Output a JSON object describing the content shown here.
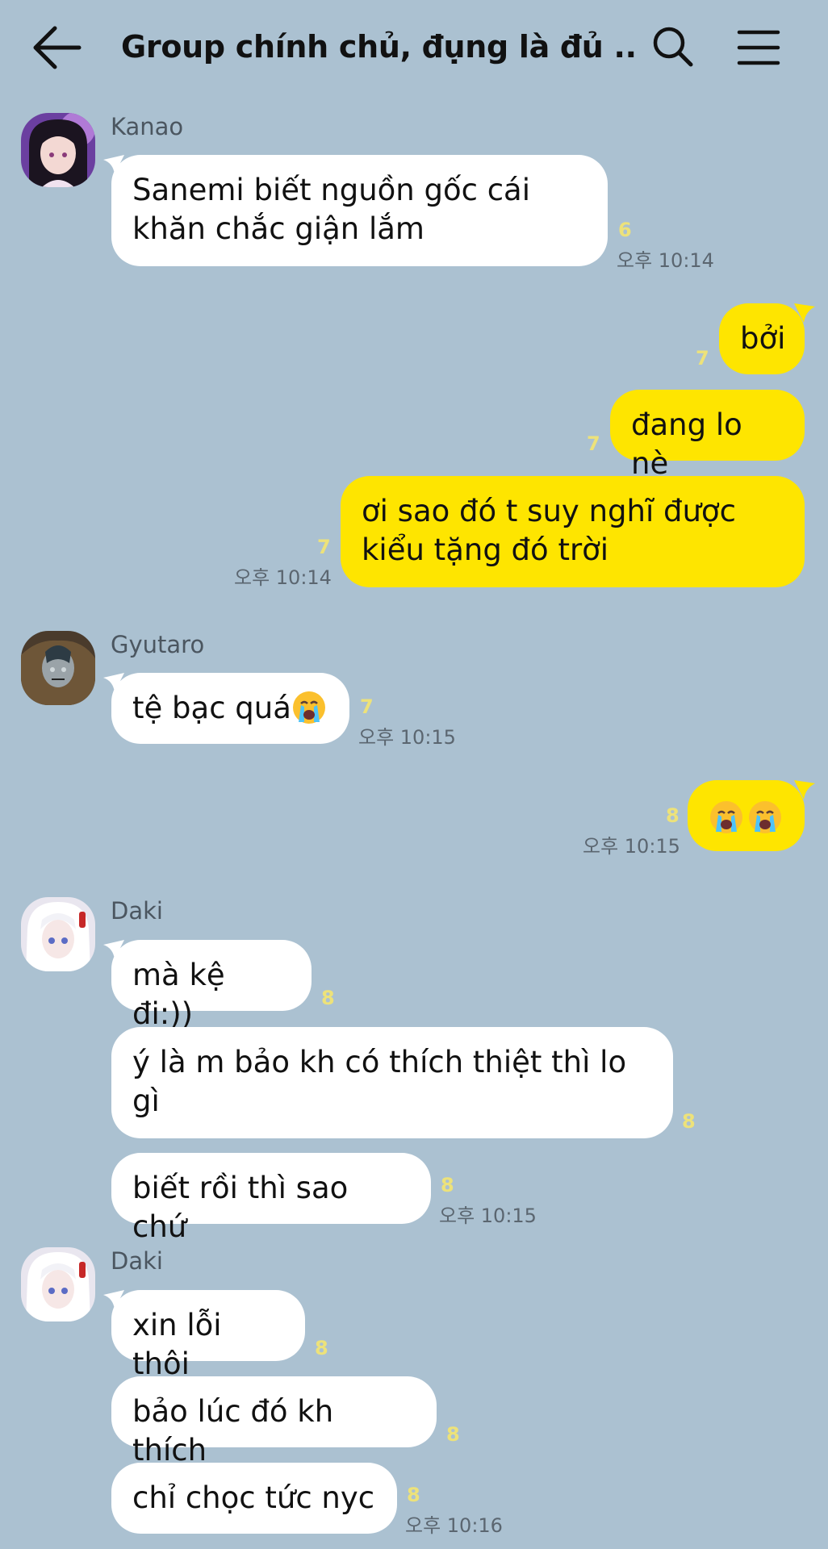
{
  "header": {
    "title": "Group chính chủ, đụng là đủ ...",
    "back_icon": "arrow-left-icon",
    "search_icon": "search-icon",
    "menu_icon": "hamburger-menu-icon"
  },
  "colors": {
    "background": "#abc1d1",
    "incoming_bubble": "#ffffff",
    "outgoing_bubble": "#fee500",
    "unread_count": "#ede27a"
  },
  "messages": [
    {
      "sender": "Kanao",
      "text": "Sanemi biết nguồn gốc cái khăn chắc giận lắm",
      "unread": "6",
      "time": "오후 10:14"
    },
    {
      "text": "bởi",
      "unread": "7"
    },
    {
      "text": "đang lo nè",
      "unread": "7"
    },
    {
      "text": "ơi sao đó t suy nghĩ được kiểu tặng đó trời",
      "unread": "7",
      "time": "오후 10:14"
    },
    {
      "sender": "Gyutaro",
      "text": "tệ bạc quá",
      "emoji": "crying-face-emoji",
      "unread": "7",
      "time": "오후 10:15"
    },
    {
      "emoji": "crying-face-emoji x2",
      "unread": "8",
      "time": "오후 10:15"
    },
    {
      "sender": "Daki",
      "text": "mà kệ đi:))",
      "unread": "8"
    },
    {
      "text": "ý là m bảo kh có thích thiệt thì lo gì",
      "unread": "8"
    },
    {
      "text": "biết rồi thì sao chứ",
      "unread": "8",
      "time": "오후 10:15"
    },
    {
      "sender": "Daki",
      "text": "xin lỗi thôi",
      "unread": "8"
    },
    {
      "text": "bảo lúc đó kh thích",
      "unread": "8"
    },
    {
      "text": "chỉ chọc tức nyc",
      "unread": "8",
      "time": "오후 10:16"
    }
  ]
}
